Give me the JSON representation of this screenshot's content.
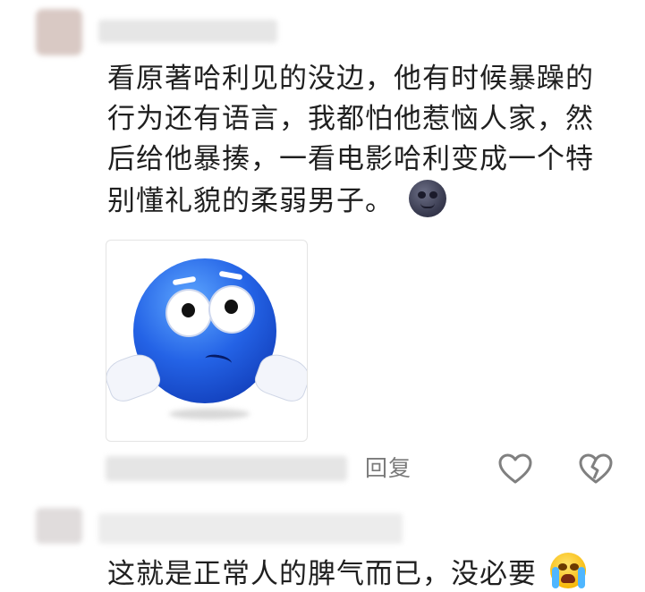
{
  "comment": {
    "text": "看原著哈利见的没边，他有时候暴躁的行为还有语言，我都怕他惹恼人家，然后给他暴揍，一看电影哈利变成一个特别懂礼貌的柔弱男子。",
    "emoji_icon": "new-moon-face-icon",
    "sticker_icon": "blue-shrugging-emoji-sticker",
    "reply_label": "回复",
    "like_icon": "heart-outline-icon",
    "dislike_icon": "broken-heart-outline-icon"
  },
  "reply_comment": {
    "text": "这就是正常人的脾气而已，没必要",
    "emoji_icon": "loudly-crying-face-icon"
  },
  "colors": {
    "text": "#1f1f1f",
    "secondary": "#7a7a7a",
    "icon": "#808080"
  }
}
